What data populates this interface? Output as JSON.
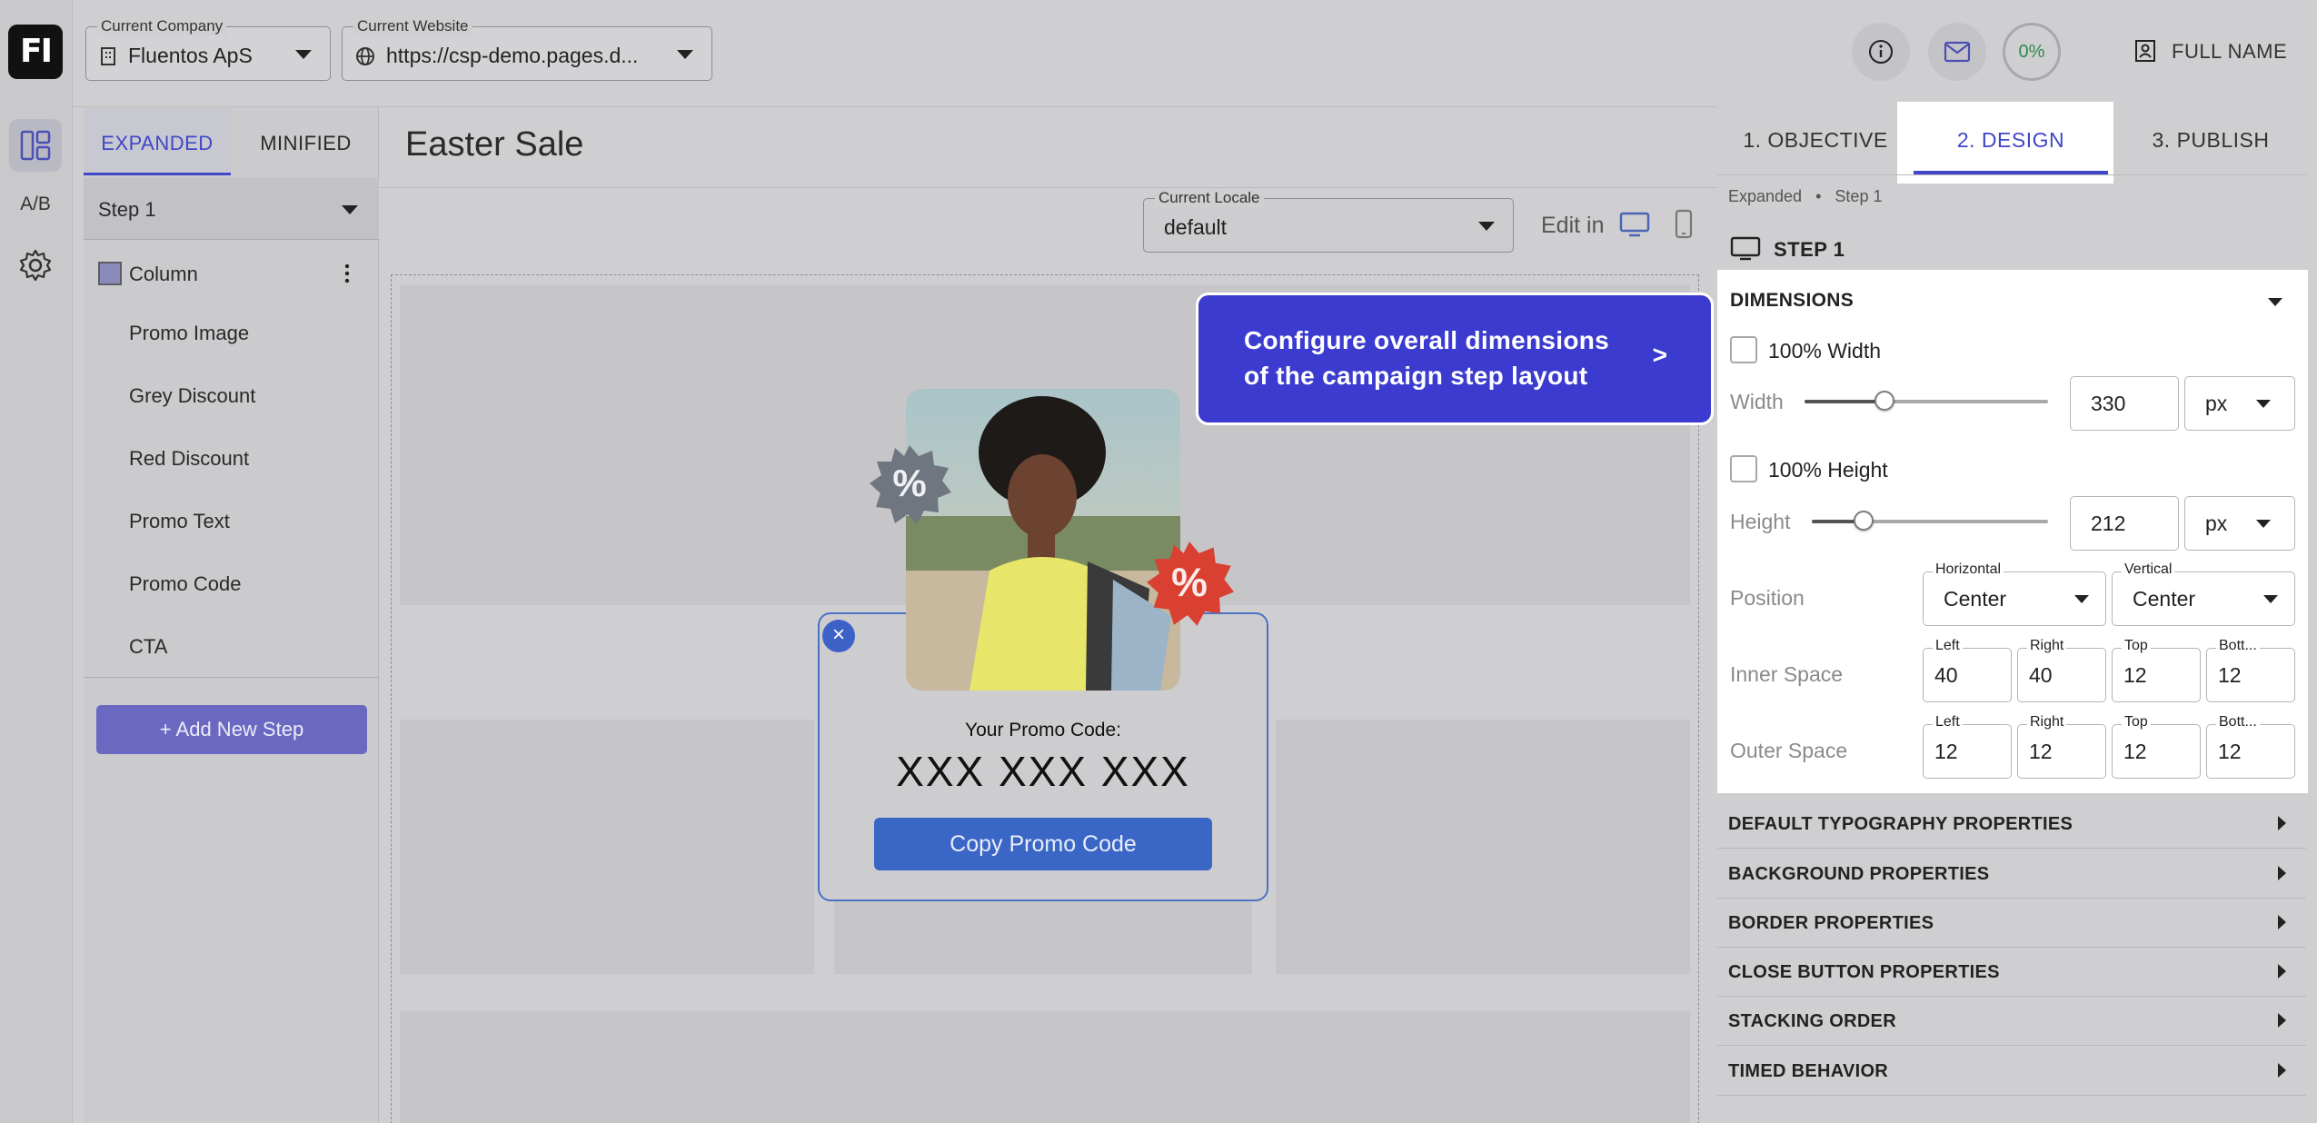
{
  "app": {
    "logo_text": "FI"
  },
  "rail": {
    "ab_label": "A/B"
  },
  "topbar": {
    "company": {
      "legend": "Current Company",
      "value": "Fluentos ApS"
    },
    "website": {
      "legend": "Current Website",
      "value": "https://csp-demo.pages.d..."
    }
  },
  "left_panel": {
    "tabs": [
      "EXPANDED",
      "MINIFIED"
    ],
    "step_select": "Step 1",
    "column_label": "Column",
    "items": [
      "Promo Image",
      "Grey Discount",
      "Red Discount",
      "Promo Text",
      "Promo Code",
      "CTA"
    ],
    "add_step": "+ Add New Step"
  },
  "canvas": {
    "title": "Easter Sale",
    "locale": {
      "legend": "Current Locale",
      "value": "default"
    },
    "edit_in": "Edit in",
    "badge_grey_text": "%",
    "badge_red_text": "%",
    "promo_label": "Your Promo Code:",
    "promo_code": "XXX XXX XXX",
    "copy_button": "Copy Promo Code",
    "close_symbol": "×"
  },
  "tooltip": {
    "text": "Configure overall dimensions of the campaign step layout",
    "arrow": ">"
  },
  "right_panel": {
    "progress_label": "0%",
    "user_name": "FULL NAME",
    "tabs": [
      "1. OBJECTIVE",
      "2. DESIGN",
      "3. PUBLISH"
    ],
    "active_tab": "2. DESIGN",
    "breadcrumb": [
      "Expanded",
      "Step 1"
    ],
    "breadcrumb_separator": "•",
    "step_title": "STEP 1",
    "dimensions": {
      "title": "DIMENSIONS",
      "width_full_label": "100% Width",
      "width_label": "Width",
      "width_value": "330",
      "width_unit": "px",
      "width_slider_fraction": 0.33,
      "height_full_label": "100% Height",
      "height_label": "Height",
      "height_value": "212",
      "height_unit": "px",
      "height_slider_fraction": 0.22,
      "position_label": "Position",
      "horizontal_legend": "Horizontal",
      "horizontal_value": "Center",
      "vertical_legend": "Vertical",
      "vertical_value": "Center",
      "inner_label": "Inner Space",
      "outer_label": "Outer Space",
      "space_legends": [
        "Left",
        "Right",
        "Top",
        "Bott..."
      ],
      "inner_values": [
        "40",
        "40",
        "12",
        "12"
      ],
      "outer_values": [
        "12",
        "12",
        "12",
        "12"
      ]
    },
    "sections": [
      "DEFAULT TYPOGRAPHY PROPERTIES",
      "BACKGROUND PROPERTIES",
      "BORDER PROPERTIES",
      "CLOSE BUTTON PROPERTIES",
      "STACKING ORDER",
      "TIMED BEHAVIOR"
    ]
  },
  "colors": {
    "accent": "#3f47c8",
    "tooltip_bg": "#3b3bcf",
    "cta": "#3a66c6",
    "red_badge": "#d94032",
    "grey_badge": "#6f7680"
  }
}
